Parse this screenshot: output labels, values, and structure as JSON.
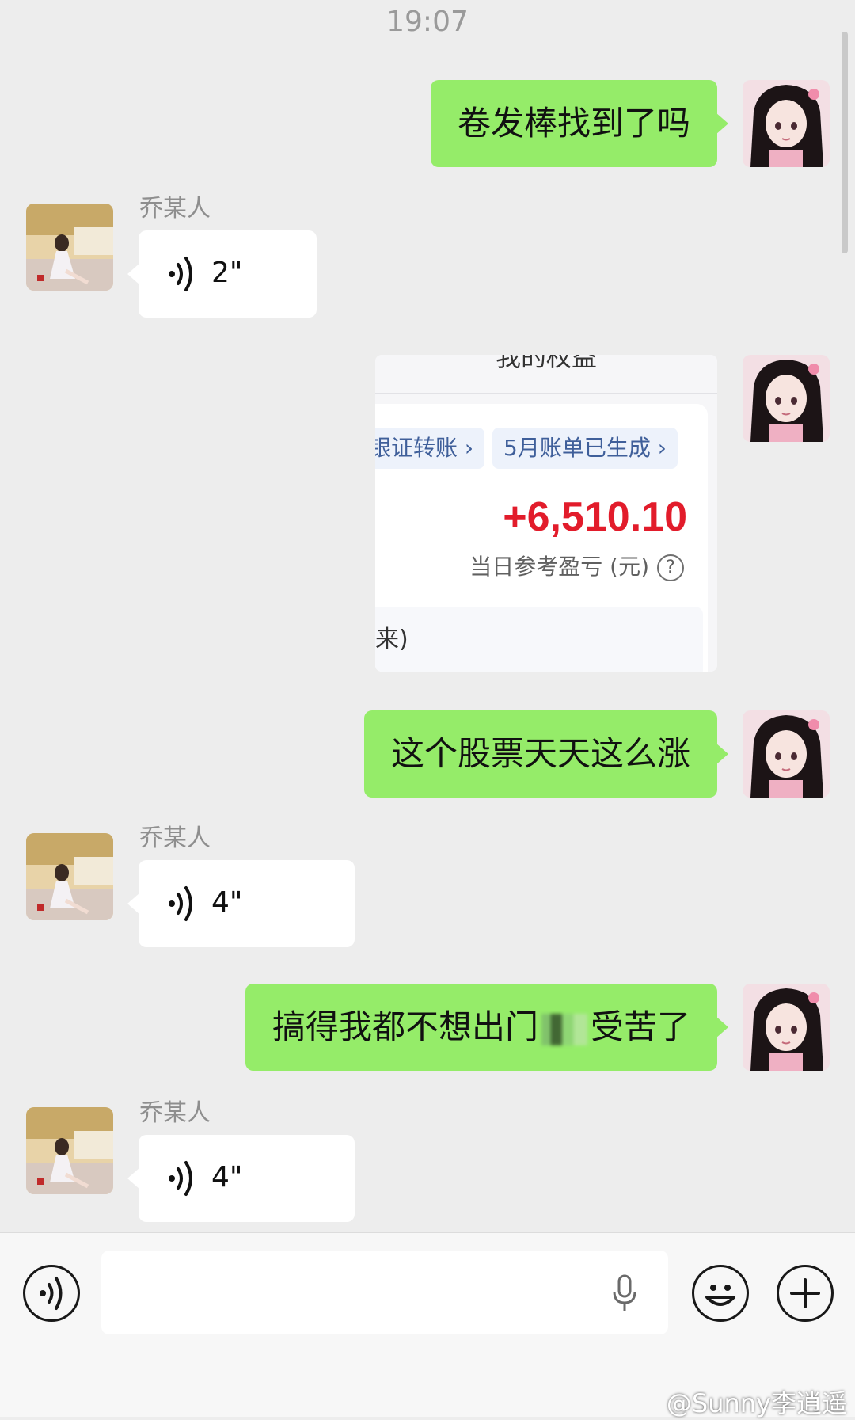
{
  "status": {
    "time": "19:07"
  },
  "contact": {
    "name": "乔某人"
  },
  "messages": {
    "m1": {
      "text": "卷发棒找到了吗"
    },
    "m2": {
      "duration": "2\""
    },
    "m3": {
      "title": "我的权益",
      "pill_left": "银证转账 ›",
      "pill_right": "5月账单已生成 ›",
      "amount": "+6,510.10",
      "caption": "当日参考盈亏 (元)",
      "help": "?",
      "footer": "来)"
    },
    "m4": {
      "text": "这个股票天天这么涨"
    },
    "m5": {
      "duration": "4\""
    },
    "m6": {
      "text_before": "搞得我都不想出门",
      "text_after": "受苦了"
    },
    "m7": {
      "duration": "4\""
    }
  },
  "input_bar": {
    "watermark": "@Sunny李逍遥"
  }
}
